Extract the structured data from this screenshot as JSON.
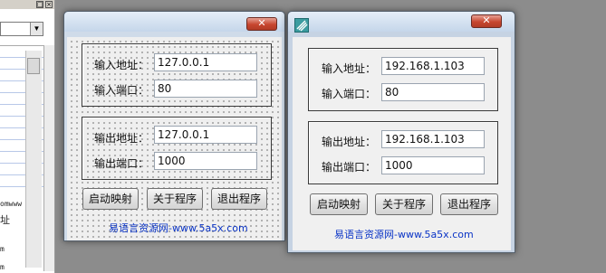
{
  "ide": {
    "combo_arrow": "▼",
    "text_lines": [
      "omwww",
      "址",
      "m",
      "m"
    ]
  },
  "window1": {
    "close_label": "✕",
    "input_address_label": "输入地址：",
    "input_address_value": "127.0.0.1",
    "input_port_label": "输入端口：",
    "input_port_value": "80",
    "output_address_label": "输出地址：",
    "output_address_value": "127.0.0.1",
    "output_port_label": "输出端口：",
    "output_port_value": "1000",
    "start_button": "启动映射",
    "about_button": "关于程序",
    "exit_button": "退出程序",
    "site_text": "易语言资源网-www.5a5x.com"
  },
  "window2": {
    "close_label": "✕",
    "input_address_label": "输入地址：",
    "input_address_value": "192.168.1.103",
    "input_port_label": "输入端口：",
    "input_port_value": "80",
    "output_address_label": "输出地址：",
    "output_address_value": "192.168.1.103",
    "output_port_label": "输出端口：",
    "output_port_value": "1000",
    "start_button": "启动映射",
    "about_button": "关于程序",
    "exit_button": "退出程序",
    "site_text": "易语言资源网-www.5a5x.com"
  }
}
